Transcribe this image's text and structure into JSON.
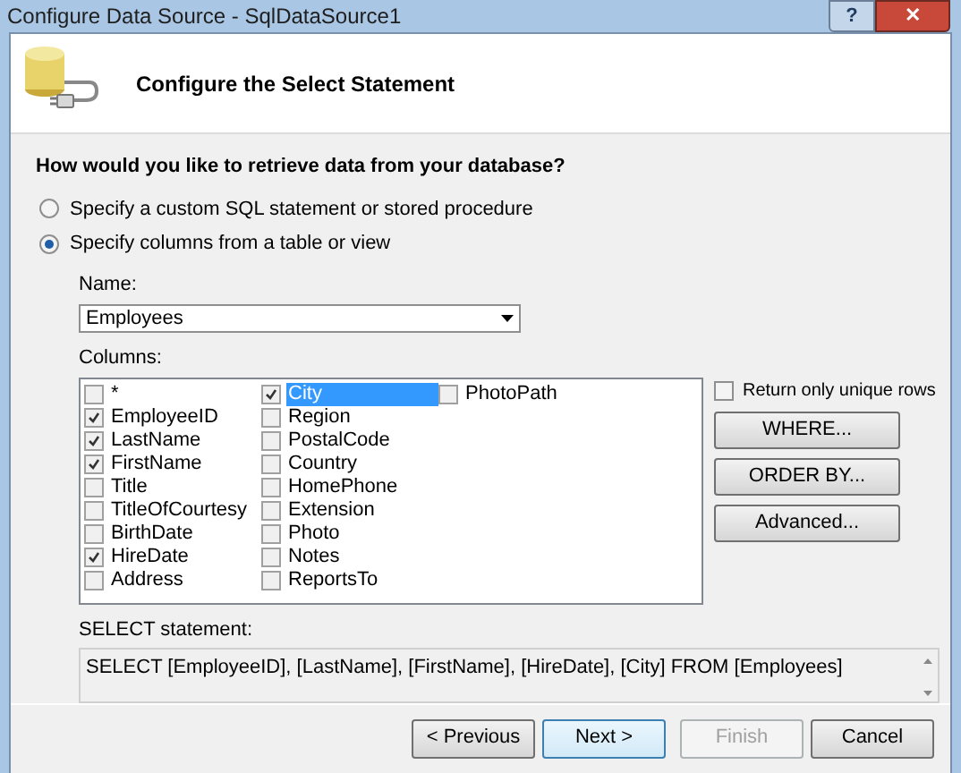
{
  "window": {
    "title": "Configure Data Source - SqlDataSource1",
    "help_button": "?",
    "close_button": "✕"
  },
  "header": {
    "title": "Configure the Select Statement"
  },
  "question": "How would you like to retrieve data from your database?",
  "options": [
    {
      "label": "Specify a custom SQL statement or stored procedure",
      "selected": false
    },
    {
      "label": "Specify columns from a table or view",
      "selected": true
    }
  ],
  "name_label": "Name:",
  "name_value": "Employees",
  "columns_label": "Columns:",
  "columns": [
    [
      {
        "label": "*",
        "checked": false,
        "selected": false
      },
      {
        "label": "EmployeeID",
        "checked": true,
        "selected": false
      },
      {
        "label": "LastName",
        "checked": true,
        "selected": false
      },
      {
        "label": "FirstName",
        "checked": true,
        "selected": false
      },
      {
        "label": "Title",
        "checked": false,
        "selected": false
      },
      {
        "label": "TitleOfCourtesy",
        "checked": false,
        "selected": false
      },
      {
        "label": "BirthDate",
        "checked": false,
        "selected": false
      },
      {
        "label": "HireDate",
        "checked": true,
        "selected": false
      },
      {
        "label": "Address",
        "checked": false,
        "selected": false
      }
    ],
    [
      {
        "label": "City",
        "checked": true,
        "selected": true
      },
      {
        "label": "Region",
        "checked": false,
        "selected": false
      },
      {
        "label": "PostalCode",
        "checked": false,
        "selected": false
      },
      {
        "label": "Country",
        "checked": false,
        "selected": false
      },
      {
        "label": "HomePhone",
        "checked": false,
        "selected": false
      },
      {
        "label": "Extension",
        "checked": false,
        "selected": false
      },
      {
        "label": "Photo",
        "checked": false,
        "selected": false
      },
      {
        "label": "Notes",
        "checked": false,
        "selected": false
      },
      {
        "label": "ReportsTo",
        "checked": false,
        "selected": false
      }
    ],
    [
      {
        "label": "PhotoPath",
        "checked": false,
        "selected": false
      }
    ]
  ],
  "unique_rows": {
    "label": "Return only unique rows",
    "checked": false
  },
  "side_buttons": [
    "WHERE...",
    "ORDER BY...",
    "Advanced..."
  ],
  "statement_label": "SELECT statement:",
  "statement": "SELECT [EmployeeID], [LastName], [FirstName], [HireDate], [City] FROM [Employees]",
  "footer_buttons": [
    {
      "label": "< Previous",
      "disabled": false,
      "default": false
    },
    {
      "label": "Next >",
      "disabled": false,
      "default": true
    },
    {
      "label": "Finish",
      "disabled": true,
      "default": false
    },
    {
      "label": "Cancel",
      "disabled": false,
      "default": false
    }
  ]
}
